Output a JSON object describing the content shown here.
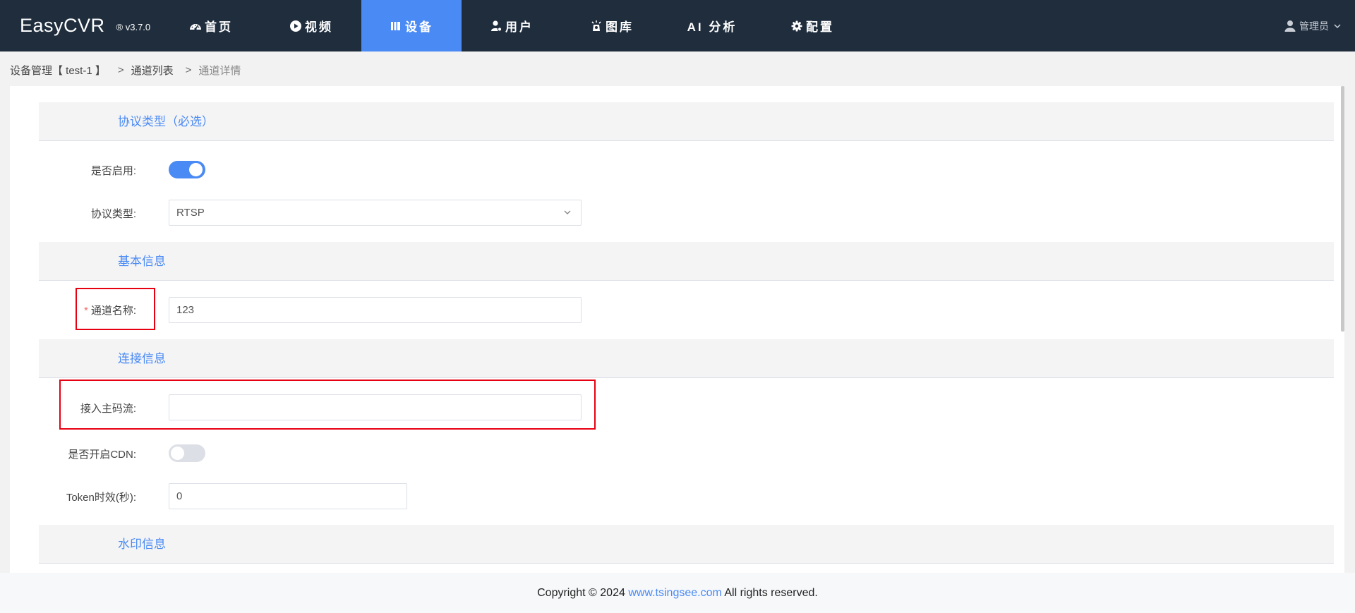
{
  "app": {
    "name": "EasyCVR",
    "version": "® v3.7.0"
  },
  "nav": {
    "items": [
      {
        "label": "首页",
        "icon": "dashboard-icon"
      },
      {
        "label": "视频",
        "icon": "play-circle-icon"
      },
      {
        "label": "设备",
        "icon": "columns-icon"
      },
      {
        "label": "用户",
        "icon": "user-gear-icon"
      },
      {
        "label": "图库",
        "icon": "camera-icon"
      },
      {
        "label": "AI 分析",
        "icon": ""
      },
      {
        "label": "配置",
        "icon": "gear-icon"
      }
    ],
    "active_index": 2,
    "active_color": "#4a8af4",
    "bar_color": "#1f2d3d"
  },
  "user": {
    "name": "管理员"
  },
  "breadcrumb": {
    "items": [
      "设备管理【 test-1 】",
      "通道列表",
      "通道详情"
    ],
    "separator": ">"
  },
  "form": {
    "sections": {
      "protocol": "协议类型（必选）",
      "basic": "基本信息",
      "connection": "连接信息",
      "watermark": "水印信息"
    },
    "enable": {
      "label": "是否启用:",
      "value": true
    },
    "protocol_type": {
      "label": "协议类型:",
      "value": "RTSP"
    },
    "channel_name": {
      "label": "通道名称:",
      "required_mark": "*",
      "value": "123"
    },
    "main_stream": {
      "label": "接入主码流:",
      "value": ""
    },
    "cdn": {
      "label": "是否开启CDN:",
      "value": false
    },
    "token": {
      "label": "Token时效(秒):",
      "value": "0"
    }
  },
  "footer": {
    "prefix": "Copyright © 2024",
    "link": "www.tsingsee.com",
    "suffix": "All rights reserved."
  }
}
